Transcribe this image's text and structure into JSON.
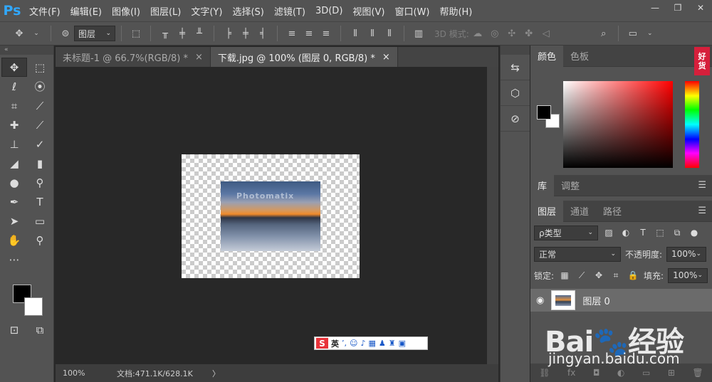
{
  "app": {
    "logo": "Ps",
    "menu": [
      "文件(F)",
      "编辑(E)",
      "图像(I)",
      "图层(L)",
      "文字(Y)",
      "选择(S)",
      "滤镜(T)",
      "3D(D)",
      "视图(V)",
      "窗口(W)",
      "帮助(H)"
    ],
    "window_controls": [
      "—",
      "❐",
      "✕"
    ]
  },
  "options": {
    "layer_select": "图层",
    "mode3d_label": "3D 模式:"
  },
  "tabs": [
    {
      "label": "未标题-1 @ 66.7%(RGB/8) *",
      "close": "×"
    },
    {
      "label": "下载.jpg @ 100% (图层 0, RGB/8) *",
      "close": "×"
    }
  ],
  "canvas": {
    "watermark": "Photomatix"
  },
  "status": {
    "zoom": "100%",
    "doc_info": "文档:471.1K/628.1K",
    "arrow": "〉"
  },
  "ime": {
    "logo": "S",
    "lang": "英"
  },
  "color_panel": {
    "tabs": [
      "颜色",
      "色板"
    ],
    "fg_color": "#000000",
    "bg_color": "#ffffff"
  },
  "library_panel": {
    "tabs": [
      "库",
      "调整"
    ]
  },
  "layers_panel": {
    "tabs": [
      "图层",
      "通道",
      "路径"
    ],
    "filter_label": "ρ类型",
    "blend_mode": "正常",
    "opacity_label": "不透明度:",
    "opacity_value": "100%",
    "lock_label": "锁定:",
    "fill_label": "填充:",
    "fill_value": "100%",
    "layers": [
      {
        "name": "图层 0",
        "visible": true
      }
    ],
    "footer_fx": "fx"
  },
  "overlays": {
    "haohuo_1": "好",
    "haohuo_2": "货",
    "baidu_logo": "Bai🐾经验",
    "baidu_url": "jingyan.baidu.com"
  }
}
